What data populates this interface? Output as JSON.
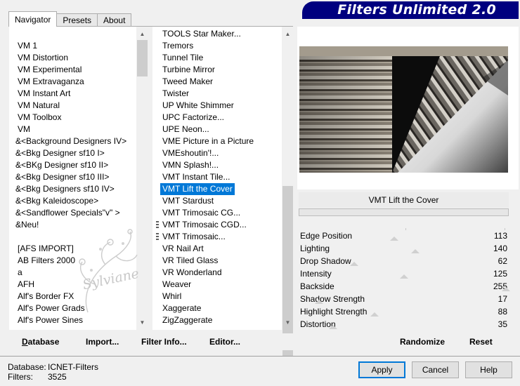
{
  "tabs": [
    "Navigator",
    "Presets",
    "About"
  ],
  "app_title": "Filters Unlimited 2.0",
  "categories": [
    "VM 1",
    "VM Distortion",
    "VM Experimental",
    "VM Extravaganza",
    "VM Instant Art",
    "VM Natural",
    "VM Toolbox",
    "VM",
    "&<Background Designers IV>",
    "&<Bkg Designer sf10 I>",
    "&<BKg Designer sf10 II>",
    "&<Bkg Designer sf10 III>",
    "&<Bkg Designers sf10 IV>",
    "&<Bkg Kaleidoscope>",
    "&<Sandflower Specials\"v\" >",
    "&Neu!",
    "",
    "[AFS IMPORT]",
    "AB Filters 2000",
    "a",
    "AFH",
    "Alf's Border FX",
    "Alf's Power Grads",
    "Alf's Power Sines"
  ],
  "filters": [
    "TOOLS Star Maker...",
    "Tremors",
    "Tunnel Tile",
    "Turbine Mirror",
    "Tweed Maker",
    "Twister",
    "UP White Shimmer",
    "UPC Factorize...",
    "UPE Neon...",
    "VME Picture in a Picture",
    "VMEshoutin'!...",
    "VMN Splash!...",
    "VMT Instant Tile...",
    "VMT Lift the Cover",
    "VMT Stardust",
    "VMT Trimosaic CG...",
    "VMT Trimosaic CGD...",
    "VMT Trimosaic...",
    "VR Nail Art",
    "VR Tiled Glass",
    "VR Wonderland",
    "Weaver",
    "Whirl",
    "Xaggerate",
    "ZigZaggerate"
  ],
  "selected_filter": "VMT Lift the Cover",
  "watermark": "Sylviane",
  "params": [
    {
      "label": "Edge Position",
      "value": "113",
      "num": 113
    },
    {
      "label": "Lighting",
      "value": "140",
      "num": 140
    },
    {
      "label": "Drop Shadow",
      "value": "62",
      "num": 62
    },
    {
      "label": "Intensity",
      "value": "125",
      "num": 125
    },
    {
      "label": "Backside",
      "value": "255",
      "num": 255
    },
    {
      "label": "Shadow Strength",
      "value": "17",
      "num": 17
    },
    {
      "label": "Highlight Strength",
      "value": "88",
      "num": 88
    },
    {
      "label": "Distortion",
      "value": "35",
      "num": 35
    }
  ],
  "buttons": {
    "database": "Database",
    "import": "Import...",
    "filter_info": "Filter Info...",
    "editor": "Editor...",
    "randomize": "Randomize",
    "reset": "Reset",
    "apply": "Apply",
    "cancel": "Cancel",
    "help": "Help"
  },
  "status": {
    "database_label": "Database:",
    "database_value": "ICNET-Filters",
    "filters_label": "Filters:",
    "filters_value": "3525"
  },
  "colors": {
    "banner": "#00007f",
    "selection": "#0078d7"
  }
}
